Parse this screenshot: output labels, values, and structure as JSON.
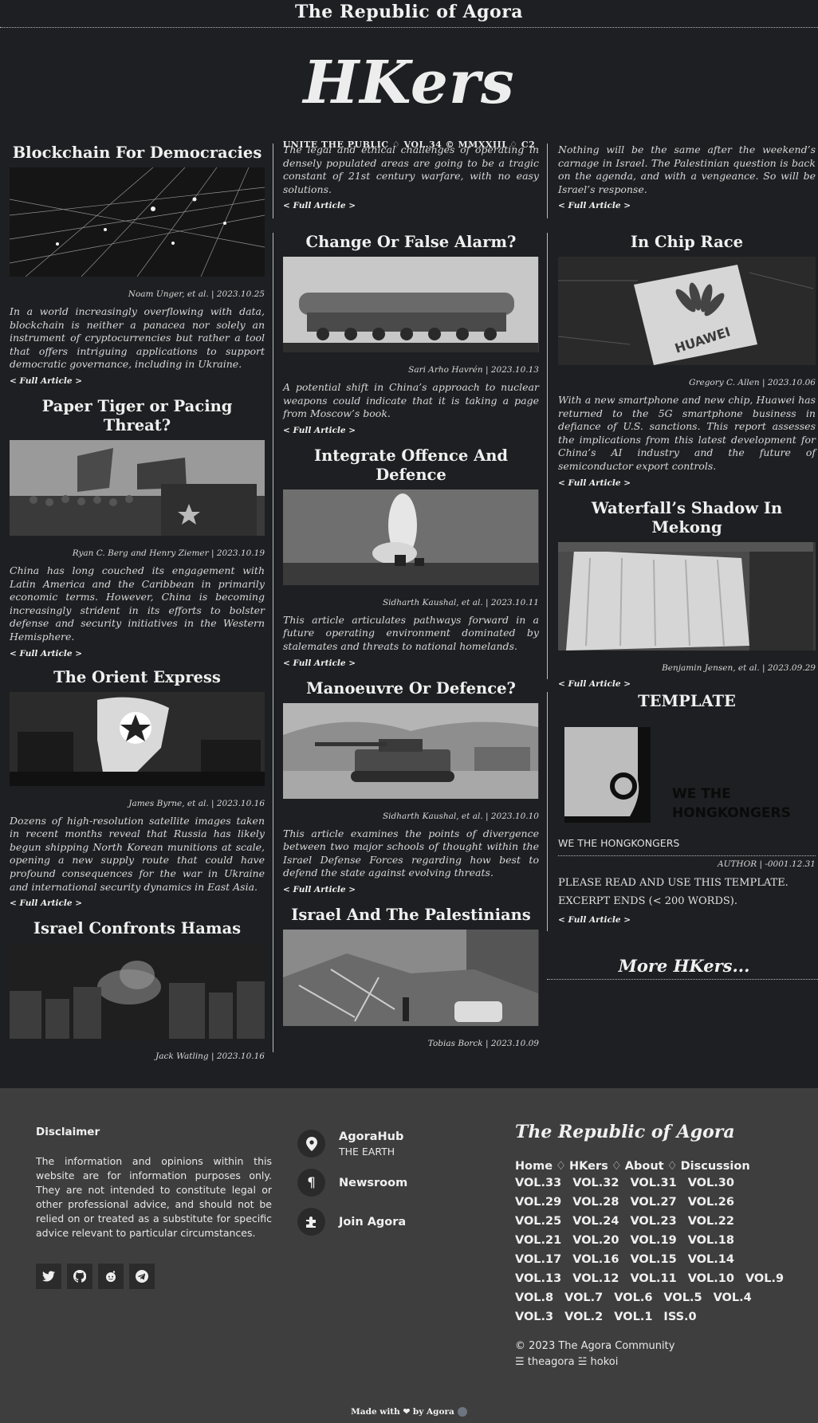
{
  "masthead": {
    "top_title": "The Republic of Agora",
    "logo": "HKers",
    "tagline": "UNITE THE PUBLIC ♢ VOL.34 © MMXXIII ♢ C2"
  },
  "col1": [
    {
      "title": "Blockchain For Democracies",
      "byline": "Noam Unger, et al. | 2023.10.25",
      "excerpt": "In a world increasingly overflowing with data, blockchain is neither a panacea nor solely an instrument of cryptocurrencies but rather a tool that offers intriguing applications to support democratic governance, including in Ukraine.",
      "more": "< Full Article >"
    },
    {
      "title": "Paper Tiger or Pacing Threat?",
      "byline": "Ryan C. Berg and Henry Ziemer | 2023.10.19",
      "excerpt": "China has long couched its engagement with Latin America and the Caribbean in primarily economic terms. However, China is becoming increasingly strident in its efforts to bolster defense and security initiatives in the Western Hemisphere.",
      "more": "< Full Article >"
    },
    {
      "title": "The Orient Express",
      "byline": "James Byrne, et al. | 2023.10.16",
      "excerpt": "Dozens of high-resolution satellite images taken in recent months reveal that Russia has likely begun shipping North Korean munitions at scale, opening a new supply route that could have profound consequences for the war in Ukraine and international security dynamics in East Asia.",
      "more": "< Full Article >"
    },
    {
      "title": "Israel Confronts Hamas",
      "byline": "Jack Watling | 2023.10.16"
    }
  ],
  "col2": {
    "lead_excerpt": "The legal and ethical challenges of operating in densely populated areas are going to be a tragic constant of 21st century warfare, with no easy solutions.",
    "lead_more": "< Full Article >",
    "articles": [
      {
        "title": "Change Or False Alarm?",
        "byline": "Sari Arho Havrén | 2023.10.13",
        "excerpt": "A potential shift in China’s approach to nuclear weapons could indicate that it is taking a page from Moscow’s book.",
        "more": "< Full Article >"
      },
      {
        "title": "Integrate Offence And Defence",
        "byline": "Sidharth Kaushal, et al. | 2023.10.11",
        "excerpt": "This article articulates pathways forward in a future operating environment dominated by stalemates and threats to national homelands.",
        "more": "< Full Article >"
      },
      {
        "title": "Manoeuvre Or Defence?",
        "byline": "Sidharth Kaushal, et al. | 2023.10.10",
        "excerpt": "This article examines the points of divergence between two major schools of thought within the Israel Defense Forces regarding how best to defend the state against evolving threats.",
        "more": "< Full Article >"
      },
      {
        "title": "Israel And The Palestinians",
        "byline": "Tobias Borck | 2023.10.09"
      }
    ]
  },
  "col3": {
    "lead_excerpt": "Nothing will be the same after the weekend’s carnage in Israel. The Palestinian question is back on the agenda, and with a vengeance. So will be Israel’s response.",
    "lead_more": "< Full Article >",
    "articles": [
      {
        "title": "In Chip Race",
        "byline": "Gregory C. Allen | 2023.10.06",
        "excerpt": "With a new smartphone and new chip, Huawei has returned to the 5G smartphone business in defiance of U.S. sanctions. This report assesses the implications from this latest development for China’s AI industry and the future of semiconductor export controls.",
        "more": "< Full Article >",
        "photo_text": "HUAWEI"
      },
      {
        "title": "Waterfall’s Shadow In Mekong",
        "byline": "Benjamin Jensen, et al. | 2023.09.29",
        "more": "< Full Article >"
      }
    ],
    "template": {
      "title": "TEMPLATE",
      "image_text_1": "WE THE",
      "image_text_2": "HONGKONGERS",
      "caption": "WE THE HONGKONGERS",
      "author": "AUTHOR | -0001.12.31",
      "line1": "PLEASE READ AND USE THIS TEMPLATE.",
      "line2": "EXCERPT ENDS (< 200 WORDS).",
      "more": "< Full Article >"
    },
    "more_hkers": "More HKers..."
  },
  "footer": {
    "disclaimer_title": "Disclaimer",
    "disclaimer_text": "The information and opinions within this website are for information purposes only. They are not intended to constitute legal or other professional advice, and should not be relied on or treated as a substitute for specific advice relevant to particular circumstances.",
    "socials": [
      "twitter-icon",
      "github-icon",
      "reddit-icon",
      "telegram-icon"
    ],
    "links": [
      {
        "icon": "location-pin-icon",
        "label": "AgoraHub",
        "sub": "THE EARTH"
      },
      {
        "icon": "pilcrow-icon",
        "label": "Newsroom",
        "sub": ""
      },
      {
        "icon": "puzzle-icon",
        "label": "Join Agora",
        "sub": ""
      }
    ],
    "brand": "The Republic of Agora",
    "nav": [
      "Home",
      "HKers",
      "About",
      "Discussion"
    ],
    "vols": [
      "VOL.33",
      "VOL.32",
      "VOL.31",
      "VOL.30",
      "VOL.29",
      "VOL.28",
      "VOL.27",
      "VOL.26",
      "VOL.25",
      "VOL.24",
      "VOL.23",
      "VOL.22",
      "VOL.21",
      "VOL.20",
      "VOL.19",
      "VOL.18",
      "VOL.17",
      "VOL.16",
      "VOL.15",
      "VOL.14",
      "VOL.13",
      "VOL.12",
      "VOL.11",
      "VOL.10",
      "VOL.9",
      "VOL.8",
      "VOL.7",
      "VOL.6",
      "VOL.5",
      "VOL.4",
      "VOL.3",
      "VOL.2",
      "VOL.1",
      "ISS.0"
    ],
    "copyright": "© 2023 The Agora Community",
    "handles": "☰ theagora ☱ hokoi",
    "made_with": "Made with ❤ by Agora"
  }
}
